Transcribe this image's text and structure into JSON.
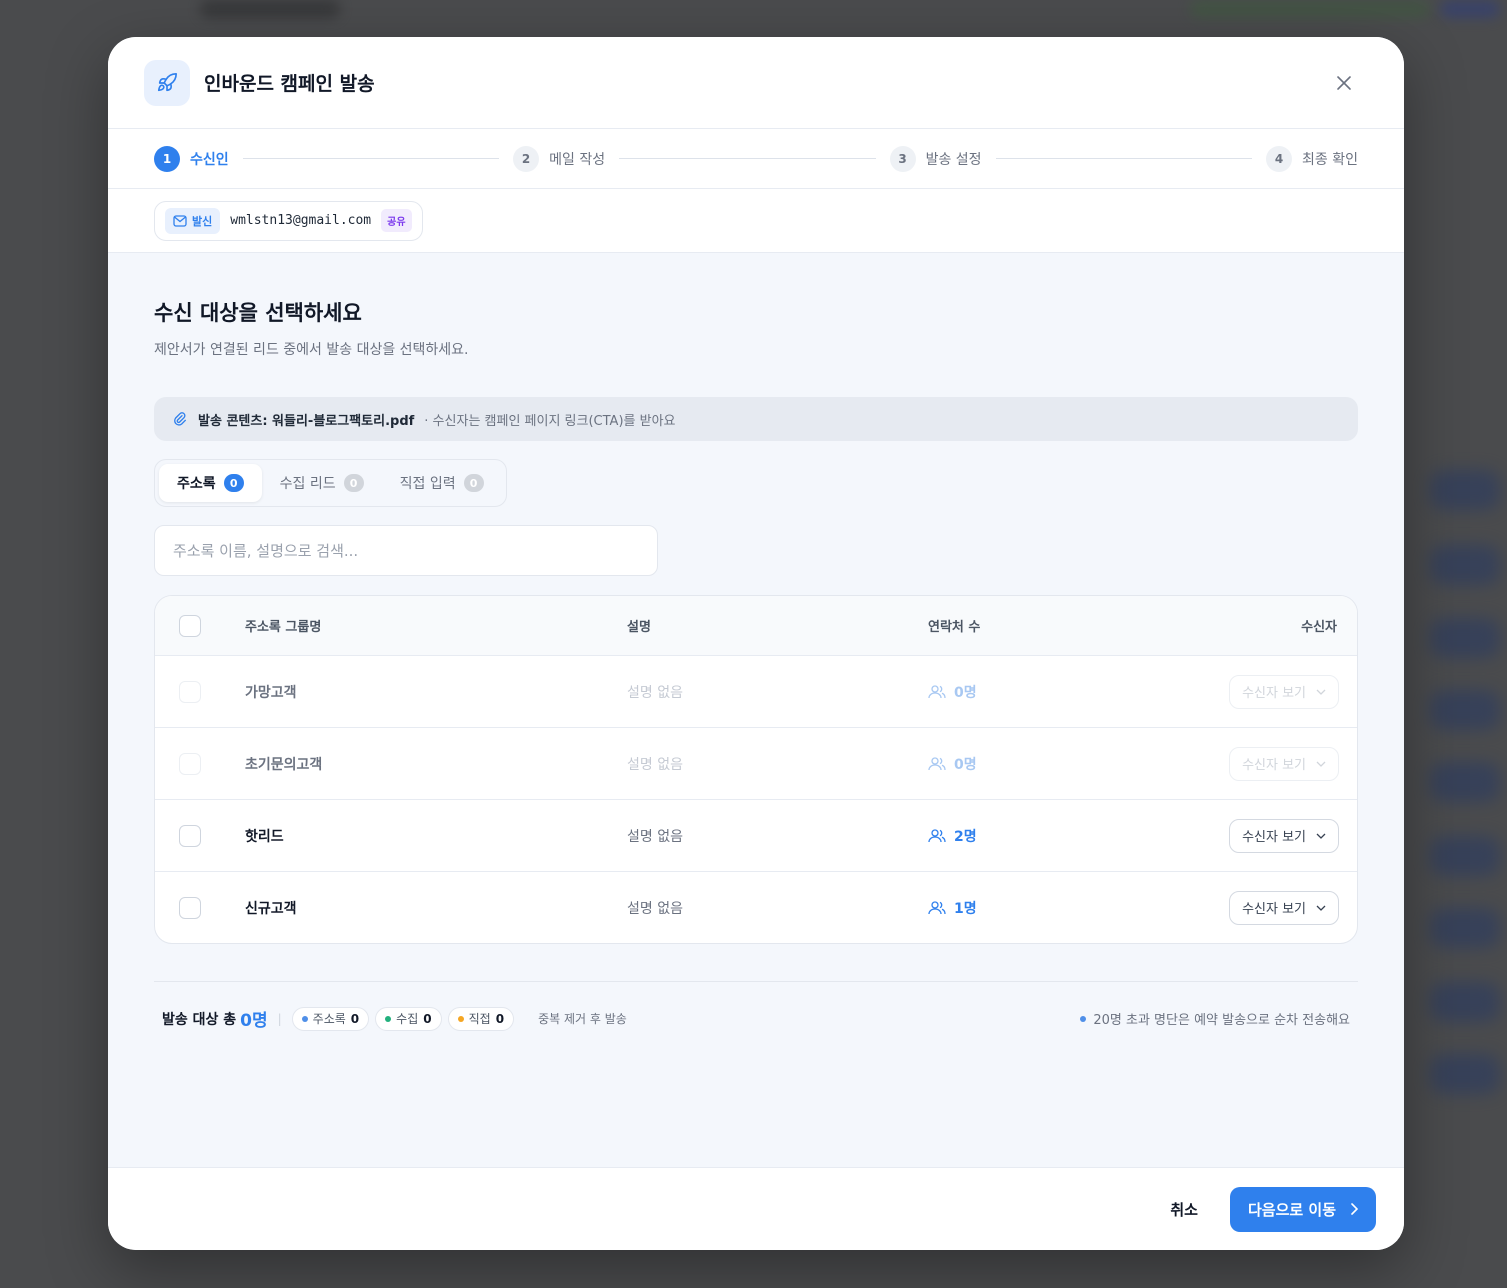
{
  "modal": {
    "title": "인바운드 캠페인 발송"
  },
  "stepper": {
    "steps": [
      {
        "num": "1",
        "label": "수신인"
      },
      {
        "num": "2",
        "label": "메일 작성"
      },
      {
        "num": "3",
        "label": "발송 설정"
      },
      {
        "num": "4",
        "label": "최종 확인"
      }
    ],
    "active_index": 0
  },
  "sender": {
    "tag_label": "발신",
    "email": "wmlstn13@gmail.com",
    "badge": "공유"
  },
  "section": {
    "title": "수신 대상을 선택하세요",
    "subtitle": "제안서가 연결된 리드 중에서 발송 대상을 선택하세요."
  },
  "content_banner": {
    "label": "발송 콘텐츠: 워들리-블로그팩토리.pdf",
    "note": "· 수신자는 캠페인 페이지 링크(CTA)를 받아요"
  },
  "tabs": [
    {
      "label": "주소록",
      "count": "0"
    },
    {
      "label": "수집 리드",
      "count": "0"
    },
    {
      "label": "직접 입력",
      "count": "0"
    }
  ],
  "search": {
    "placeholder": "주소록 이름, 설명으로 검색..."
  },
  "table": {
    "headers": {
      "name": "주소록 그룹명",
      "desc": "설명",
      "count": "연락처 수",
      "recipients": "수신자"
    },
    "rows": [
      {
        "name": "가망고객",
        "desc": "설명 없음",
        "count": "0명",
        "view_label": "수신자 보기"
      },
      {
        "name": "초기문의고객",
        "desc": "설명 없음",
        "count": "0명",
        "view_label": "수신자 보기"
      },
      {
        "name": "핫리드",
        "desc": "설명 없음",
        "count": "2명",
        "view_label": "수신자 보기"
      },
      {
        "name": "신규고객",
        "desc": "설명 없음",
        "count": "1명",
        "view_label": "수신자 보기"
      }
    ]
  },
  "summary": {
    "label": "발송 대상 총",
    "total": "0명",
    "chips": [
      {
        "label": "주소록",
        "count": "0",
        "color": "#4f8fe8"
      },
      {
        "label": "수집",
        "count": "0",
        "color": "#22b07d"
      },
      {
        "label": "직접",
        "count": "0",
        "color": "#f5a623"
      }
    ],
    "dedupe": "중복 제거 후 발송",
    "note": "20명 초과 명단은 예약 발송으로 순차 전송해요",
    "note_color": "#4f8fe8"
  },
  "footer": {
    "cancel": "취소",
    "next": "다음으로 이동"
  },
  "colors": {
    "accent": "#2f80ed"
  }
}
